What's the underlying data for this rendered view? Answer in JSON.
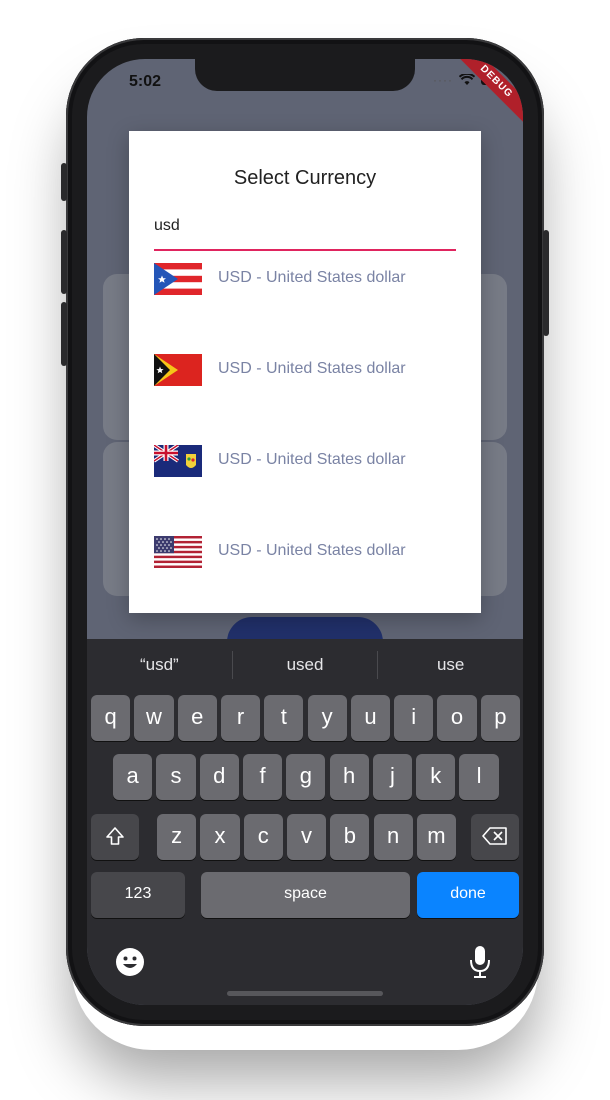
{
  "status": {
    "time": "5:02",
    "debug_label": "DEBUG"
  },
  "dialog": {
    "title": "Select Currency",
    "search_value": "usd",
    "items": [
      {
        "flag": "puerto-rico-flag",
        "label": "USD - United States dollar"
      },
      {
        "flag": "east-timor-flag",
        "label": "USD - United States dollar"
      },
      {
        "flag": "turks-caicos-flag",
        "label": "USD - United States dollar"
      },
      {
        "flag": "usa-flag",
        "label": "USD - United States dollar"
      }
    ]
  },
  "keyboard": {
    "suggestions": [
      "“usd”",
      "used",
      "use"
    ],
    "row1": [
      "q",
      "w",
      "e",
      "r",
      "t",
      "y",
      "u",
      "i",
      "o",
      "p"
    ],
    "row2": [
      "a",
      "s",
      "d",
      "f",
      "g",
      "h",
      "j",
      "k",
      "l"
    ],
    "row3": [
      "z",
      "x",
      "c",
      "v",
      "b",
      "n",
      "m"
    ],
    "numbers_label": "123",
    "space_label": "space",
    "done_label": "done"
  },
  "colors": {
    "accent": "#e0245e",
    "done": "#0a84ff",
    "item_text": "#7a83a4"
  }
}
